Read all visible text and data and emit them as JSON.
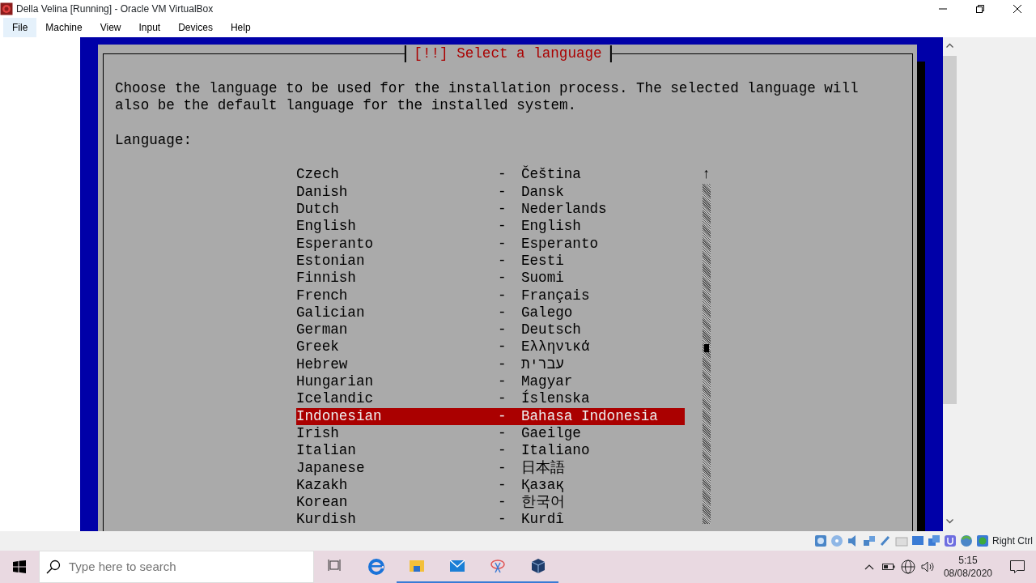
{
  "window": {
    "title": "Della Velina [Running] - Oracle VM VirtualBox"
  },
  "menu": [
    {
      "label": "File",
      "selected": true
    },
    {
      "label": "Machine",
      "selected": false
    },
    {
      "label": "View",
      "selected": false
    },
    {
      "label": "Input",
      "selected": false
    },
    {
      "label": "Devices",
      "selected": false
    },
    {
      "label": "Help",
      "selected": false
    }
  ],
  "installer": {
    "dialog_title": "[!!] Select a language",
    "prompt_lines": [
      "Choose the language to be used for the installation process. The selected language will",
      "also be the default language for the installed system."
    ],
    "field_label": "Language:",
    "scroll_up": "↑",
    "languages": [
      {
        "name": "Czech",
        "separator": "-",
        "native": "Čeština",
        "selected": false
      },
      {
        "name": "Danish",
        "separator": "-",
        "native": "Dansk",
        "selected": false
      },
      {
        "name": "Dutch",
        "separator": "-",
        "native": "Nederlands",
        "selected": false
      },
      {
        "name": "English",
        "separator": "-",
        "native": "English",
        "selected": false
      },
      {
        "name": "Esperanto",
        "separator": "-",
        "native": "Esperanto",
        "selected": false
      },
      {
        "name": "Estonian",
        "separator": "-",
        "native": "Eesti",
        "selected": false
      },
      {
        "name": "Finnish",
        "separator": "-",
        "native": "Suomi",
        "selected": false
      },
      {
        "name": "French",
        "separator": "-",
        "native": "Français",
        "selected": false
      },
      {
        "name": "Galician",
        "separator": "-",
        "native": "Galego",
        "selected": false
      },
      {
        "name": "German",
        "separator": "-",
        "native": "Deutsch",
        "selected": false
      },
      {
        "name": "Greek",
        "separator": "-",
        "native": "Ελληνικά",
        "selected": false
      },
      {
        "name": "Hebrew",
        "separator": "-",
        "native": "עברית",
        "selected": false
      },
      {
        "name": "Hungarian",
        "separator": "-",
        "native": "Magyar",
        "selected": false
      },
      {
        "name": "Icelandic",
        "separator": "-",
        "native": "Íslenska",
        "selected": false
      },
      {
        "name": "Indonesian",
        "separator": "-",
        "native": "Bahasa Indonesia",
        "selected": true
      },
      {
        "name": "Irish",
        "separator": "-",
        "native": "Gaeilge",
        "selected": false
      },
      {
        "name": "Italian",
        "separator": "-",
        "native": "Italiano",
        "selected": false
      },
      {
        "name": "Japanese",
        "separator": "-",
        "native": "日本語",
        "selected": false
      },
      {
        "name": "Kazakh",
        "separator": "-",
        "native": "Қазақ",
        "selected": false
      },
      {
        "name": "Korean",
        "separator": "-",
        "native": "한국어",
        "selected": false
      },
      {
        "name": "Kurdish",
        "separator": "-",
        "native": "Kurdî",
        "selected": false
      }
    ]
  },
  "status_bar": {
    "host_key": "Right Ctrl"
  },
  "taskbar": {
    "search": {
      "placeholder": "Type here to search"
    },
    "time": "5:15",
    "date": "08/08/2020"
  }
}
